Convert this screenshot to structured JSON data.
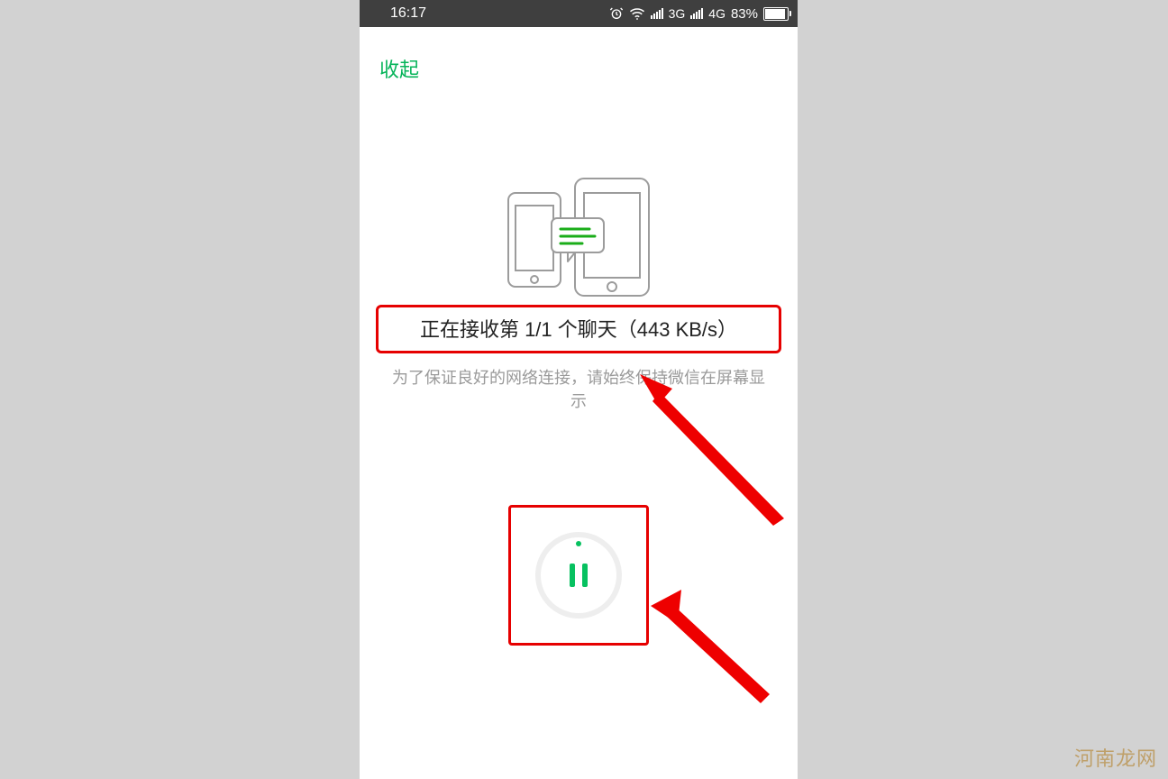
{
  "statusbar": {
    "time": "16:17",
    "signal_a_label": "3G",
    "signal_b_label": "4G",
    "battery_pct": "83%"
  },
  "topbar": {
    "collapse_label": "收起"
  },
  "transfer": {
    "status_text": "正在接收第 1/1 个聊天（443 KB/s）",
    "hint_text": "为了保证良好的网络连接，请始终保持微信在屏幕显示"
  },
  "controls": {
    "pause_label": "pause"
  },
  "watermark": "河南龙网"
}
